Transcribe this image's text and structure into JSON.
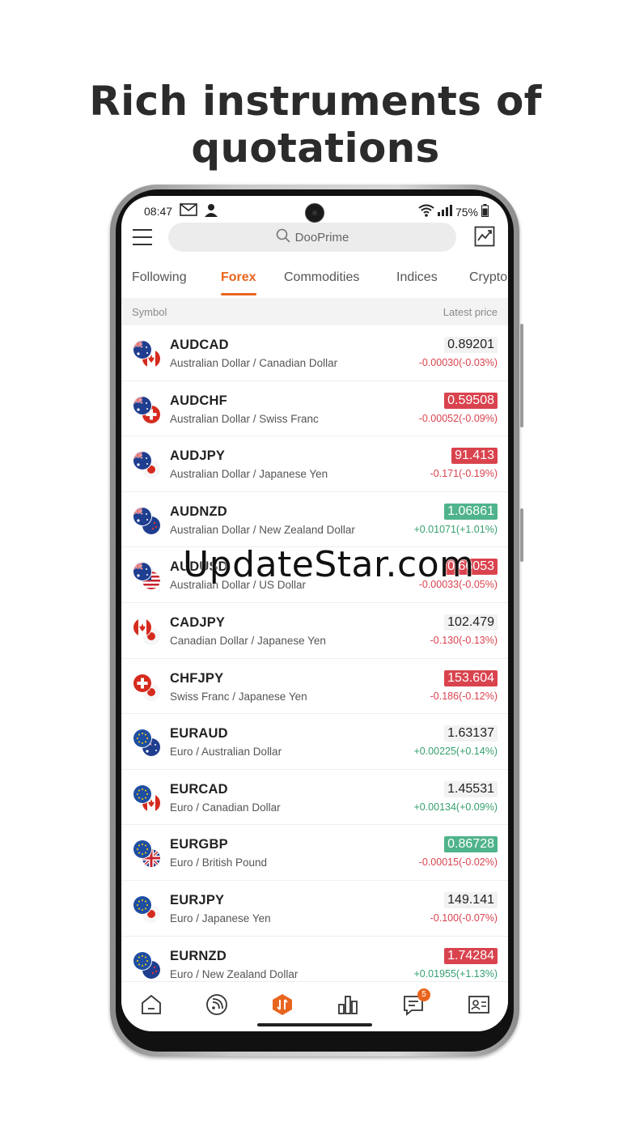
{
  "headline": "Rich instruments of quotations",
  "watermark": "UpdateStar.com",
  "status": {
    "time": "08:47",
    "battery": "75%"
  },
  "search": {
    "placeholder": "DooPrime"
  },
  "tabs": [
    "Following",
    "Forex",
    "Commodities",
    "Indices",
    "Crypto"
  ],
  "active_tab": "Forex",
  "columns": {
    "symbol": "Symbol",
    "price": "Latest price"
  },
  "quotes": [
    {
      "symbol": "AUDCAD",
      "name": "Australian Dollar / Canadian Dollar",
      "price": "0.89201",
      "change": "-0.00030(-0.03%)",
      "flags": [
        "AU",
        "CA"
      ],
      "highlight": "none",
      "direction": "neg"
    },
    {
      "symbol": "AUDCHF",
      "name": "Australian Dollar / Swiss Franc",
      "price": "0.59508",
      "change": "-0.00052(-0.09%)",
      "flags": [
        "AU",
        "CH"
      ],
      "highlight": "down",
      "direction": "neg"
    },
    {
      "symbol": "AUDJPY",
      "name": "Australian Dollar / Japanese Yen",
      "price": "91.413",
      "change": "-0.171(-0.19%)",
      "flags": [
        "AU",
        "JP"
      ],
      "highlight": "down",
      "direction": "neg"
    },
    {
      "symbol": "AUDNZD",
      "name": "Australian Dollar / New Zealand Dollar",
      "price": "1.06861",
      "change": "+0.01071(+1.01%)",
      "flags": [
        "AU",
        "NZ"
      ],
      "highlight": "up",
      "direction": "pos"
    },
    {
      "symbol": "AUDUSD",
      "name": "Australian Dollar / US Dollar",
      "price": "0.66053",
      "change": "-0.00033(-0.05%)",
      "flags": [
        "AU",
        "US"
      ],
      "highlight": "down",
      "direction": "neg"
    },
    {
      "symbol": "CADJPY",
      "name": "Canadian Dollar / Japanese Yen",
      "price": "102.479",
      "change": "-0.130(-0.13%)",
      "flags": [
        "CA",
        "JP"
      ],
      "highlight": "none",
      "direction": "neg"
    },
    {
      "symbol": "CHFJPY",
      "name": "Swiss Franc / Japanese Yen",
      "price": "153.604",
      "change": "-0.186(-0.12%)",
      "flags": [
        "CH",
        "JP"
      ],
      "highlight": "down",
      "direction": "neg"
    },
    {
      "symbol": "EURAUD",
      "name": "Euro / Australian Dollar",
      "price": "1.63137",
      "change": "+0.00225(+0.14%)",
      "flags": [
        "EU",
        "AU"
      ],
      "highlight": "none",
      "direction": "pos"
    },
    {
      "symbol": "EURCAD",
      "name": "Euro / Canadian Dollar",
      "price": "1.45531",
      "change": "+0.00134(+0.09%)",
      "flags": [
        "EU",
        "CA"
      ],
      "highlight": "none",
      "direction": "pos"
    },
    {
      "symbol": "EURGBP",
      "name": "Euro / British Pound",
      "price": "0.86728",
      "change": "-0.00015(-0.02%)",
      "flags": [
        "EU",
        "GB"
      ],
      "highlight": "up",
      "direction": "neg"
    },
    {
      "symbol": "EURJPY",
      "name": "Euro / Japanese Yen",
      "price": "149.141",
      "change": "-0.100(-0.07%)",
      "flags": [
        "EU",
        "JP"
      ],
      "highlight": "none",
      "direction": "neg"
    },
    {
      "symbol": "EURNZD",
      "name": "Euro / New Zealand Dollar",
      "price": "1.74284",
      "change": "+0.01955(+1.13%)",
      "flags": [
        "EU",
        "NZ"
      ],
      "highlight": "down",
      "direction": "pos"
    }
  ],
  "nav": {
    "items": [
      "home-icon",
      "feed-icon",
      "trade-icon",
      "markets-icon",
      "messages-icon",
      "profile-icon"
    ],
    "messages_badge": "5"
  },
  "colors": {
    "accent": "#e8651e",
    "down": "#d9434e",
    "up": "#4fb38b"
  }
}
